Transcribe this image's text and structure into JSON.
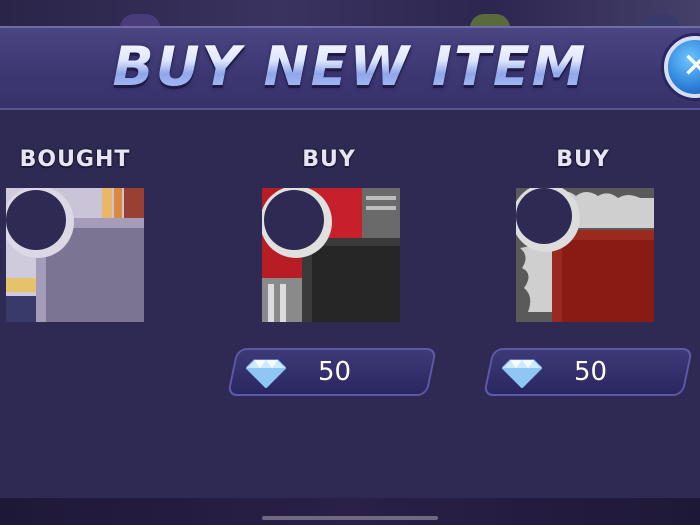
{
  "title": "BUY NEW ITEM",
  "close_icon": "close-icon",
  "items": [
    {
      "status_label": "BOUGHT",
      "image": "silver-purple-table-corner"
    },
    {
      "status_label": "BUY",
      "image": "red-black-table-corner",
      "price": "50",
      "currency_icon": "diamond-icon"
    },
    {
      "status_label": "BUY",
      "image": "ornate-red-table-corner",
      "price": "50",
      "currency_icon": "diamond-icon"
    }
  ],
  "colors": {
    "panel": "#2f2a53",
    "header": "#3d3872",
    "button_border": "#5d58a6",
    "close_button": "#2a7fd8"
  }
}
